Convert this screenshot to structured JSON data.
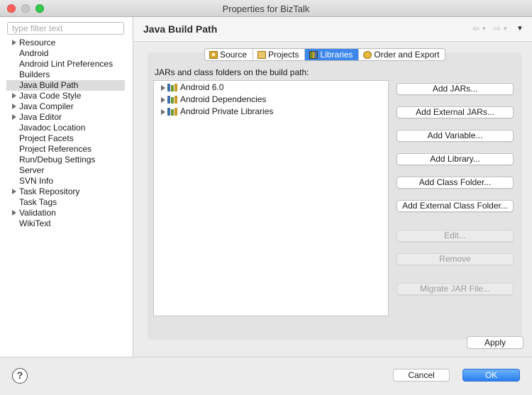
{
  "window": {
    "title": "Properties for BizTalk",
    "controls": {
      "close": "#fc605b",
      "minimize": "#c8c8c8",
      "maximize": "#34c84a"
    }
  },
  "sidebar": {
    "filter_placeholder": "type filter text",
    "items": [
      {
        "label": "Resource",
        "expandable": true
      },
      {
        "label": "Android",
        "expandable": false
      },
      {
        "label": "Android Lint Preferences",
        "expandable": false
      },
      {
        "label": "Builders",
        "expandable": false
      },
      {
        "label": "Java Build Path",
        "expandable": false,
        "selected": true
      },
      {
        "label": "Java Code Style",
        "expandable": true
      },
      {
        "label": "Java Compiler",
        "expandable": true
      },
      {
        "label": "Java Editor",
        "expandable": true
      },
      {
        "label": "Javadoc Location",
        "expandable": false
      },
      {
        "label": "Project Facets",
        "expandable": false
      },
      {
        "label": "Project References",
        "expandable": false
      },
      {
        "label": "Run/Debug Settings",
        "expandable": false
      },
      {
        "label": "Server",
        "expandable": false
      },
      {
        "label": "SVN Info",
        "expandable": false
      },
      {
        "label": "Task Repository",
        "expandable": true
      },
      {
        "label": "Task Tags",
        "expandable": false
      },
      {
        "label": "Validation",
        "expandable": true
      },
      {
        "label": "WikiText",
        "expandable": false
      }
    ]
  },
  "header": {
    "title": "Java Build Path",
    "nav_back": "⇦",
    "nav_forward": "⇨",
    "nav_dropdown": "▾",
    "menu": "▼"
  },
  "tabs": [
    {
      "label": "Source",
      "icon": "source-folder-icon",
      "active": false
    },
    {
      "label": "Projects",
      "icon": "projects-icon",
      "active": false
    },
    {
      "label": "Libraries",
      "icon": "libraries-icon",
      "active": true
    },
    {
      "label": "Order and Export",
      "icon": "order-export-icon",
      "active": false
    }
  ],
  "libraries": {
    "section_label": "JARs and class folders on the build path:",
    "items": [
      {
        "label": "Android 6.0"
      },
      {
        "label": "Android Dependencies"
      },
      {
        "label": "Android Private Libraries"
      }
    ],
    "buttons": [
      {
        "label": "Add JARs...",
        "enabled": true
      },
      {
        "label": "Add External JARs...",
        "enabled": true
      },
      {
        "label": "Add Variable...",
        "enabled": true
      },
      {
        "label": "Add Library...",
        "enabled": true
      },
      {
        "label": "Add Class Folder...",
        "enabled": true
      },
      {
        "label": "Add External Class Folder...",
        "enabled": true
      },
      {
        "label": "Edit...",
        "enabled": false
      },
      {
        "label": "Remove",
        "enabled": false
      },
      {
        "label": "Migrate JAR File...",
        "enabled": false
      }
    ]
  },
  "apply_label": "Apply",
  "footer": {
    "help_symbol": "?",
    "cancel_label": "Cancel",
    "ok_label": "OK",
    "accent": "#2a7ff0"
  }
}
